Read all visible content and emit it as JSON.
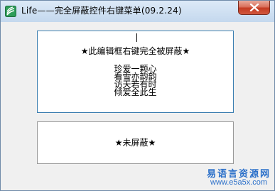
{
  "window": {
    "title": "Life——完全屏蔽控件右键菜单(09.2.24)",
    "icon": "app-icon",
    "close_icon": "close-icon"
  },
  "edit_top": {
    "heading": "★此编辑框右键完全被屏蔽★",
    "poem": [
      "珍爱一颗心",
      "看雪亦韵韵",
      "访天若有时",
      "倾爱全此生"
    ]
  },
  "edit_bottom": {
    "label": "★未屏蔽★"
  },
  "watermark": {
    "site_name": "易语言资源网",
    "url": "www.e5a5x.com"
  },
  "colors": {
    "title_gradient": "#cfe0f2",
    "close_button": "#c43b22",
    "edit_border_focused": "#3c7fb1",
    "watermark": "#2a6fc9"
  }
}
